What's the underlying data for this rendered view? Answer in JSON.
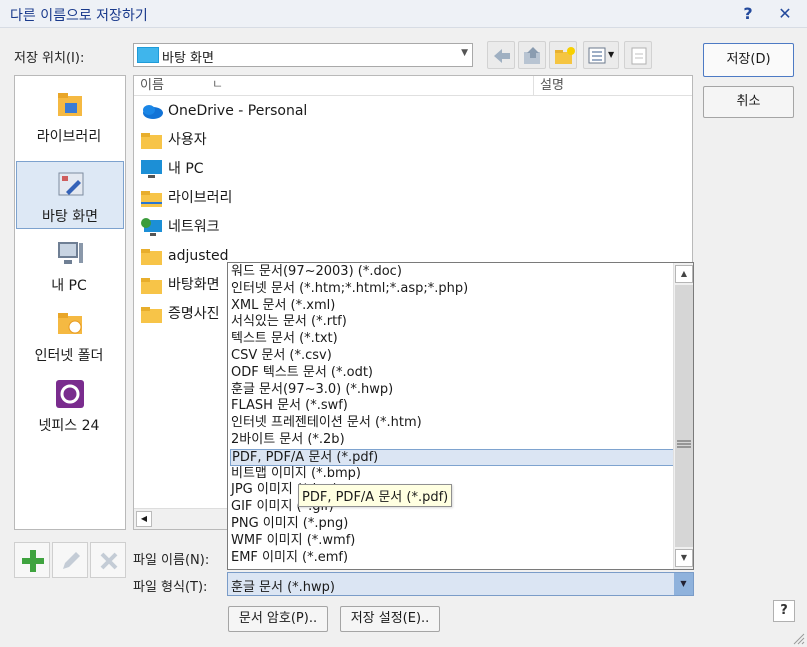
{
  "window": {
    "title": "다른 이름으로 저장하기",
    "help_glyph": "?",
    "close_glyph": "✕"
  },
  "location": {
    "label": "저장 위치(I):",
    "value": "바탕 화면"
  },
  "buttons": {
    "save": "저장(D)",
    "cancel": "취소",
    "doc_password": "문서 암호(P)..",
    "save_settings": "저장 설정(E).."
  },
  "places": [
    {
      "label": "라이브러리",
      "icon": "library-icon"
    },
    {
      "label": "바탕 화면",
      "icon": "desktop-icon",
      "selected": true
    },
    {
      "label": "내 PC",
      "icon": "computer-icon"
    },
    {
      "label": "인터넷 폴더",
      "icon": "internet-folder-icon"
    },
    {
      "label": "넷피스 24",
      "icon": "netffice-icon"
    }
  ],
  "columns": {
    "name": "이름",
    "sort_glyph": "ㄴ",
    "desc": "설명"
  },
  "files": [
    {
      "name": "OneDrive - Personal",
      "icon": "onedrive-icon"
    },
    {
      "name": "사용자",
      "icon": "folder-icon"
    },
    {
      "name": "내 PC",
      "icon": "computer-icon"
    },
    {
      "name": "라이브러리",
      "icon": "library-folder-icon"
    },
    {
      "name": "네트워크",
      "icon": "network-icon"
    },
    {
      "name": "adjusted",
      "icon": "folder-icon"
    },
    {
      "name": "바탕화면",
      "icon": "folder-icon"
    },
    {
      "name": "증명사진",
      "icon": "folder-icon"
    }
  ],
  "filename": {
    "label": "파일 이름(N):"
  },
  "filetype": {
    "label": "파일 형식(T):",
    "value": "훈글 문서 (*.hwp)",
    "options": [
      "워드 문서(97~2003) (*.doc)",
      "인터넷 문서 (*.htm;*.html;*.asp;*.php)",
      "XML 문서 (*.xml)",
      "서식있는 문서 (*.rtf)",
      "텍스트 문서 (*.txt)",
      "CSV 문서 (*.csv)",
      "ODF 텍스트 문서 (*.odt)",
      "훈글 문서(97~3.0) (*.hwp)",
      "FLASH 문서 (*.swf)",
      "인터넷 프레젠테이션 문서 (*.htm)",
      "2바이트 문서 (*.2b)",
      "PDF, PDF/A 문서 (*.pdf)",
      "비트맵 이미지 (*.bmp)",
      "JPG 이미지 (*.jpg)",
      "GIF 이미지 (*.gif)",
      "PNG 이미지 (*.png)",
      "WMF 이미지 (*.wmf)",
      "EMF 이미지 (*.emf)"
    ],
    "highlighted_index": 11
  },
  "tooltip": "PDF, PDF/A 문서 (*.pdf)",
  "help_small_glyph": "?"
}
